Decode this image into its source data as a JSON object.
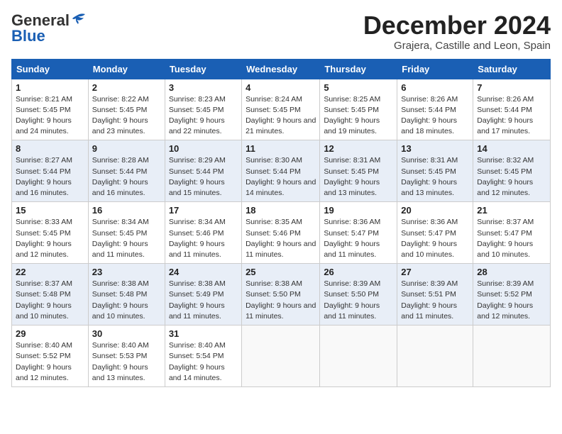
{
  "header": {
    "logo_general": "General",
    "logo_blue": "Blue",
    "month_title": "December 2024",
    "location": "Grajera, Castille and Leon, Spain"
  },
  "columns": [
    "Sunday",
    "Monday",
    "Tuesday",
    "Wednesday",
    "Thursday",
    "Friday",
    "Saturday"
  ],
  "weeks": [
    [
      {
        "day": "1",
        "sunrise": "Sunrise: 8:21 AM",
        "sunset": "Sunset: 5:45 PM",
        "daylight": "Daylight: 9 hours and 24 minutes."
      },
      {
        "day": "2",
        "sunrise": "Sunrise: 8:22 AM",
        "sunset": "Sunset: 5:45 PM",
        "daylight": "Daylight: 9 hours and 23 minutes."
      },
      {
        "day": "3",
        "sunrise": "Sunrise: 8:23 AM",
        "sunset": "Sunset: 5:45 PM",
        "daylight": "Daylight: 9 hours and 22 minutes."
      },
      {
        "day": "4",
        "sunrise": "Sunrise: 8:24 AM",
        "sunset": "Sunset: 5:45 PM",
        "daylight": "Daylight: 9 hours and 21 minutes."
      },
      {
        "day": "5",
        "sunrise": "Sunrise: 8:25 AM",
        "sunset": "Sunset: 5:45 PM",
        "daylight": "Daylight: 9 hours and 19 minutes."
      },
      {
        "day": "6",
        "sunrise": "Sunrise: 8:26 AM",
        "sunset": "Sunset: 5:44 PM",
        "daylight": "Daylight: 9 hours and 18 minutes."
      },
      {
        "day": "7",
        "sunrise": "Sunrise: 8:26 AM",
        "sunset": "Sunset: 5:44 PM",
        "daylight": "Daylight: 9 hours and 17 minutes."
      }
    ],
    [
      {
        "day": "8",
        "sunrise": "Sunrise: 8:27 AM",
        "sunset": "Sunset: 5:44 PM",
        "daylight": "Daylight: 9 hours and 16 minutes."
      },
      {
        "day": "9",
        "sunrise": "Sunrise: 8:28 AM",
        "sunset": "Sunset: 5:44 PM",
        "daylight": "Daylight: 9 hours and 16 minutes."
      },
      {
        "day": "10",
        "sunrise": "Sunrise: 8:29 AM",
        "sunset": "Sunset: 5:44 PM",
        "daylight": "Daylight: 9 hours and 15 minutes."
      },
      {
        "day": "11",
        "sunrise": "Sunrise: 8:30 AM",
        "sunset": "Sunset: 5:44 PM",
        "daylight": "Daylight: 9 hours and 14 minutes."
      },
      {
        "day": "12",
        "sunrise": "Sunrise: 8:31 AM",
        "sunset": "Sunset: 5:45 PM",
        "daylight": "Daylight: 9 hours and 13 minutes."
      },
      {
        "day": "13",
        "sunrise": "Sunrise: 8:31 AM",
        "sunset": "Sunset: 5:45 PM",
        "daylight": "Daylight: 9 hours and 13 minutes."
      },
      {
        "day": "14",
        "sunrise": "Sunrise: 8:32 AM",
        "sunset": "Sunset: 5:45 PM",
        "daylight": "Daylight: 9 hours and 12 minutes."
      }
    ],
    [
      {
        "day": "15",
        "sunrise": "Sunrise: 8:33 AM",
        "sunset": "Sunset: 5:45 PM",
        "daylight": "Daylight: 9 hours and 12 minutes."
      },
      {
        "day": "16",
        "sunrise": "Sunrise: 8:34 AM",
        "sunset": "Sunset: 5:45 PM",
        "daylight": "Daylight: 9 hours and 11 minutes."
      },
      {
        "day": "17",
        "sunrise": "Sunrise: 8:34 AM",
        "sunset": "Sunset: 5:46 PM",
        "daylight": "Daylight: 9 hours and 11 minutes."
      },
      {
        "day": "18",
        "sunrise": "Sunrise: 8:35 AM",
        "sunset": "Sunset: 5:46 PM",
        "daylight": "Daylight: 9 hours and 11 minutes."
      },
      {
        "day": "19",
        "sunrise": "Sunrise: 8:36 AM",
        "sunset": "Sunset: 5:47 PM",
        "daylight": "Daylight: 9 hours and 11 minutes."
      },
      {
        "day": "20",
        "sunrise": "Sunrise: 8:36 AM",
        "sunset": "Sunset: 5:47 PM",
        "daylight": "Daylight: 9 hours and 10 minutes."
      },
      {
        "day": "21",
        "sunrise": "Sunrise: 8:37 AM",
        "sunset": "Sunset: 5:47 PM",
        "daylight": "Daylight: 9 hours and 10 minutes."
      }
    ],
    [
      {
        "day": "22",
        "sunrise": "Sunrise: 8:37 AM",
        "sunset": "Sunset: 5:48 PM",
        "daylight": "Daylight: 9 hours and 10 minutes."
      },
      {
        "day": "23",
        "sunrise": "Sunrise: 8:38 AM",
        "sunset": "Sunset: 5:48 PM",
        "daylight": "Daylight: 9 hours and 10 minutes."
      },
      {
        "day": "24",
        "sunrise": "Sunrise: 8:38 AM",
        "sunset": "Sunset: 5:49 PM",
        "daylight": "Daylight: 9 hours and 11 minutes."
      },
      {
        "day": "25",
        "sunrise": "Sunrise: 8:38 AM",
        "sunset": "Sunset: 5:50 PM",
        "daylight": "Daylight: 9 hours and 11 minutes."
      },
      {
        "day": "26",
        "sunrise": "Sunrise: 8:39 AM",
        "sunset": "Sunset: 5:50 PM",
        "daylight": "Daylight: 9 hours and 11 minutes."
      },
      {
        "day": "27",
        "sunrise": "Sunrise: 8:39 AM",
        "sunset": "Sunset: 5:51 PM",
        "daylight": "Daylight: 9 hours and 11 minutes."
      },
      {
        "day": "28",
        "sunrise": "Sunrise: 8:39 AM",
        "sunset": "Sunset: 5:52 PM",
        "daylight": "Daylight: 9 hours and 12 minutes."
      }
    ],
    [
      {
        "day": "29",
        "sunrise": "Sunrise: 8:40 AM",
        "sunset": "Sunset: 5:52 PM",
        "daylight": "Daylight: 9 hours and 12 minutes."
      },
      {
        "day": "30",
        "sunrise": "Sunrise: 8:40 AM",
        "sunset": "Sunset: 5:53 PM",
        "daylight": "Daylight: 9 hours and 13 minutes."
      },
      {
        "day": "31",
        "sunrise": "Sunrise: 8:40 AM",
        "sunset": "Sunset: 5:54 PM",
        "daylight": "Daylight: 9 hours and 14 minutes."
      },
      null,
      null,
      null,
      null
    ]
  ]
}
